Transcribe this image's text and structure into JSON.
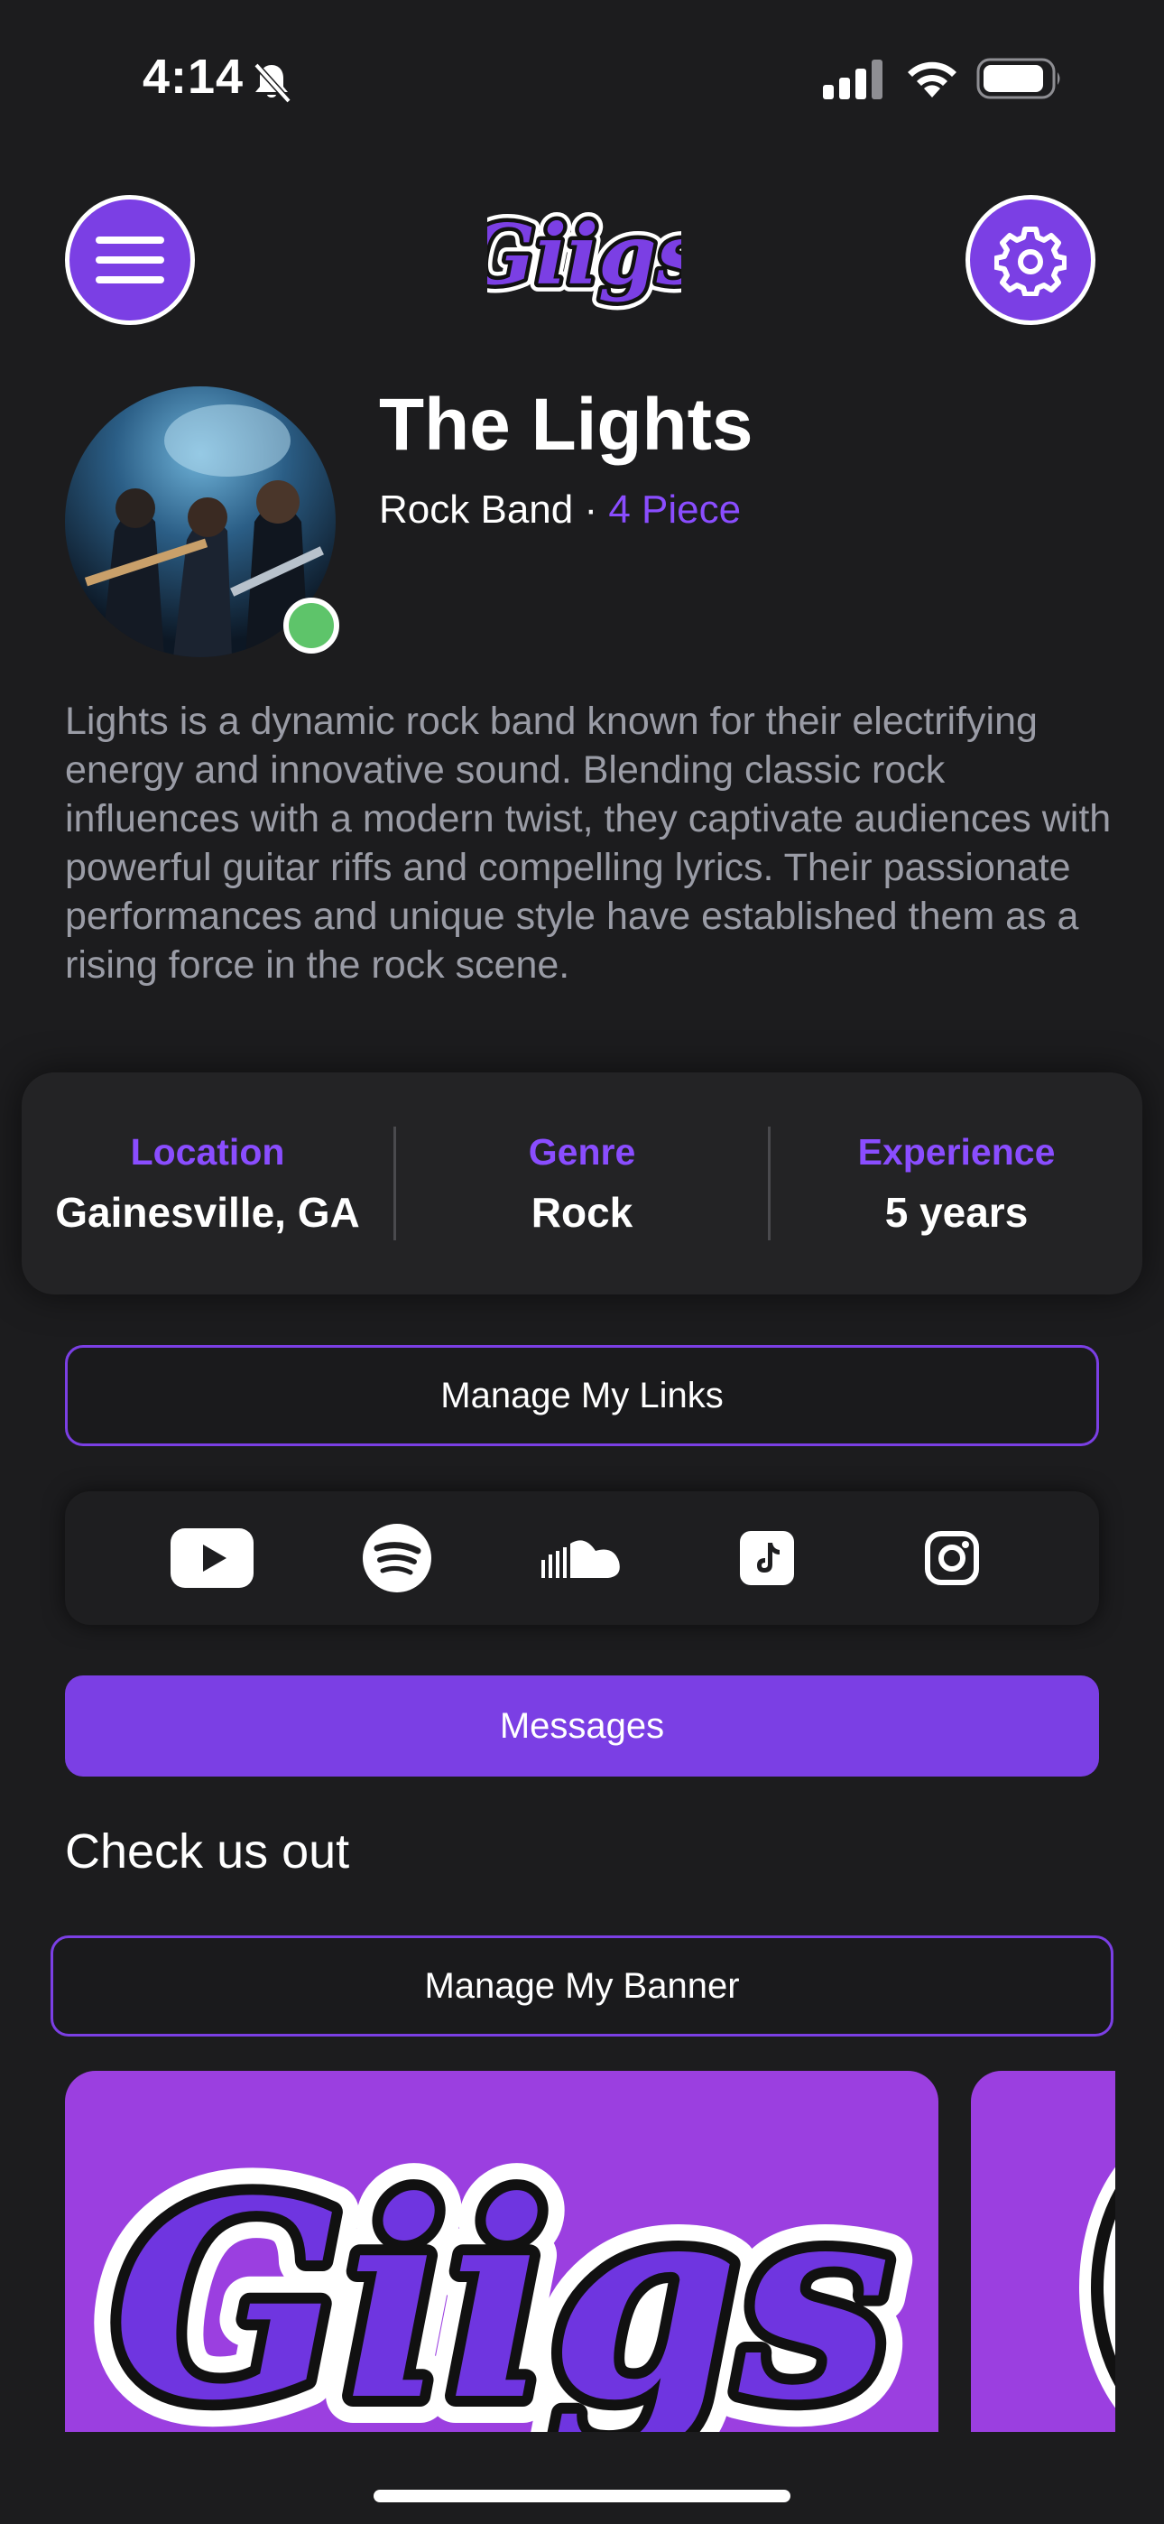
{
  "status_bar": {
    "time": "4:14"
  },
  "app": {
    "logo_text": "Giigs"
  },
  "profile": {
    "name": "The Lights",
    "type": "Rock Band",
    "separator": " · ",
    "size": "4 Piece",
    "online": true,
    "bio": "Lights is a dynamic rock band known for their electrifying energy and innovative sound. Blending classic rock influences with a modern twist, they captivate audiences with powerful guitar riffs and compelling lyrics. Their passionate performances and unique style have established them as a rising force in the rock scene."
  },
  "stats": [
    {
      "label": "Location",
      "value": "Gainesville, GA"
    },
    {
      "label": "Genre",
      "value": "Rock"
    },
    {
      "label": "Experience",
      "value": "5 years"
    }
  ],
  "buttons": {
    "manage_links": "Manage My Links",
    "messages": "Messages",
    "manage_banner": "Manage My Banner"
  },
  "social_links": [
    "youtube-icon",
    "spotify-icon",
    "soundcloud-icon",
    "tiktok-icon",
    "instagram-icon"
  ],
  "sections": {
    "check_us_out": "Check us out"
  },
  "colors": {
    "accent": "#7b3fe4",
    "accent_text": "#8a4dff",
    "background": "#1c1c1e",
    "online": "#5ec46a",
    "banner_bg": "#9b3fe0"
  }
}
